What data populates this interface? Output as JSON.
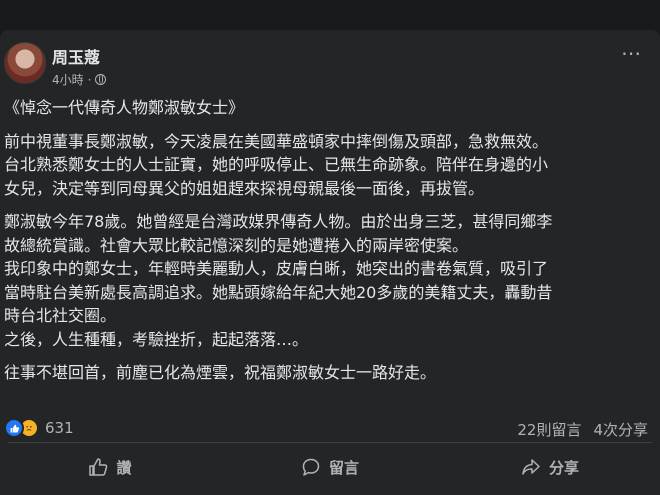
{
  "post": {
    "author": "周玉蔻",
    "time": "4小時",
    "time_sep": "·",
    "more_icon": "⋯",
    "paragraphs": [
      "《悼念一代傳奇人物鄭淑敏女士》",
      "前中視董事長鄭淑敏，今天凌晨在美國華盛頓家中摔倒傷及頭部，急救無效。\n台北熟悉鄭女士的人士証實，她的呼吸停止、已無生命跡象。陪伴在身邊的小\n女兒，決定等到同母異父的姐姐趕來探視母親最後一面後，再拔管。",
      "鄭淑敏今年78歲。她曾經是台灣政媒界傳奇人物。由於出身三芝，甚得同鄉李\n故總統賞識。社會大眾比較記憶深刻的是她遭捲入的兩岸密使案。\n我印象中的鄭女士，年輕時美麗動人，皮膚白晰，她突出的書卷氣質，吸引了\n當時駐台美新處長高調追求。她點頭嫁給年紀大她20多歲的美籍丈夫，轟動昔\n時台北社交圈。\n之後，人生種種，考驗挫折，起起落落…。",
      "往事不堪回首，前塵已化為煙雲，祝福鄭淑敏女士一路好走。"
    ]
  },
  "stats": {
    "reaction_count": "631",
    "comments": "22則留言",
    "shares": "4次分享"
  },
  "actions": {
    "like": "讚",
    "comment": "留言",
    "share": "分享"
  },
  "colors": {
    "card": "#242526",
    "page": "#18191a",
    "like_blue": "#2078f4"
  }
}
